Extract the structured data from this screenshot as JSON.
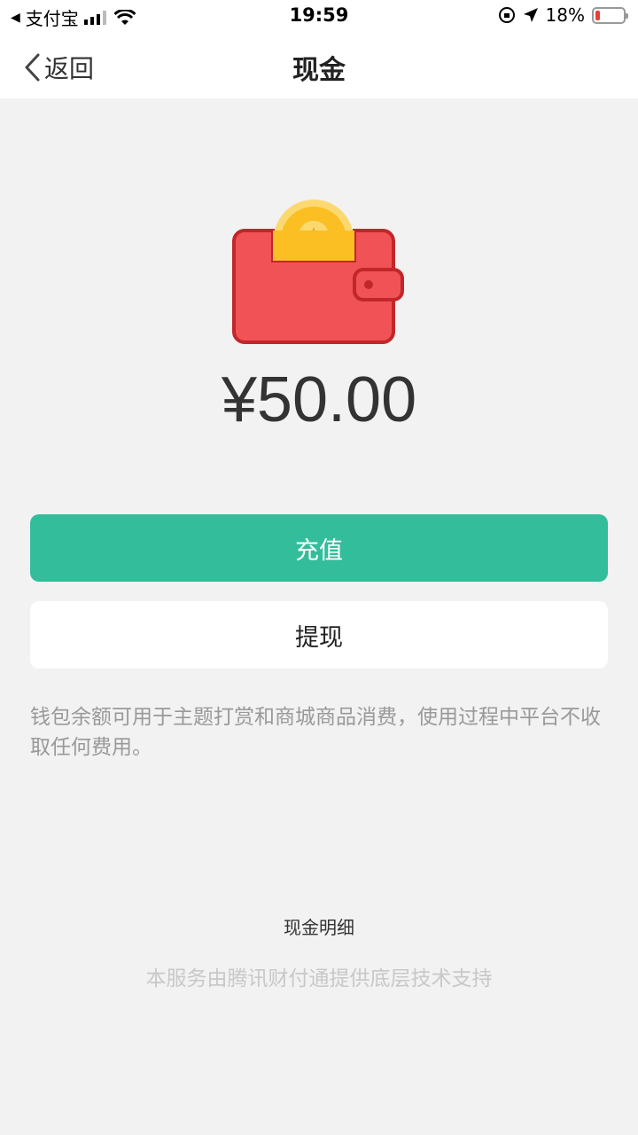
{
  "status_bar": {
    "back_app": "支付宝",
    "time": "19:59",
    "battery": "18%",
    "battery_level": 0.18
  },
  "nav": {
    "back_label": "返回",
    "title": "现金"
  },
  "balance": {
    "amount": "¥50.00"
  },
  "actions": {
    "recharge_label": "充值",
    "withdraw_label": "提现"
  },
  "notice": "钱包余额可用于主题打赏和商城商品消费，使用过程中平台不收取任何费用。",
  "detail_link": "现金明细",
  "footer_note": "本服务由腾讯财付通提供底层技术支持",
  "colors": {
    "primary": "#33bd9b",
    "wallet": "#f05255",
    "coin": "#fcc93b"
  }
}
